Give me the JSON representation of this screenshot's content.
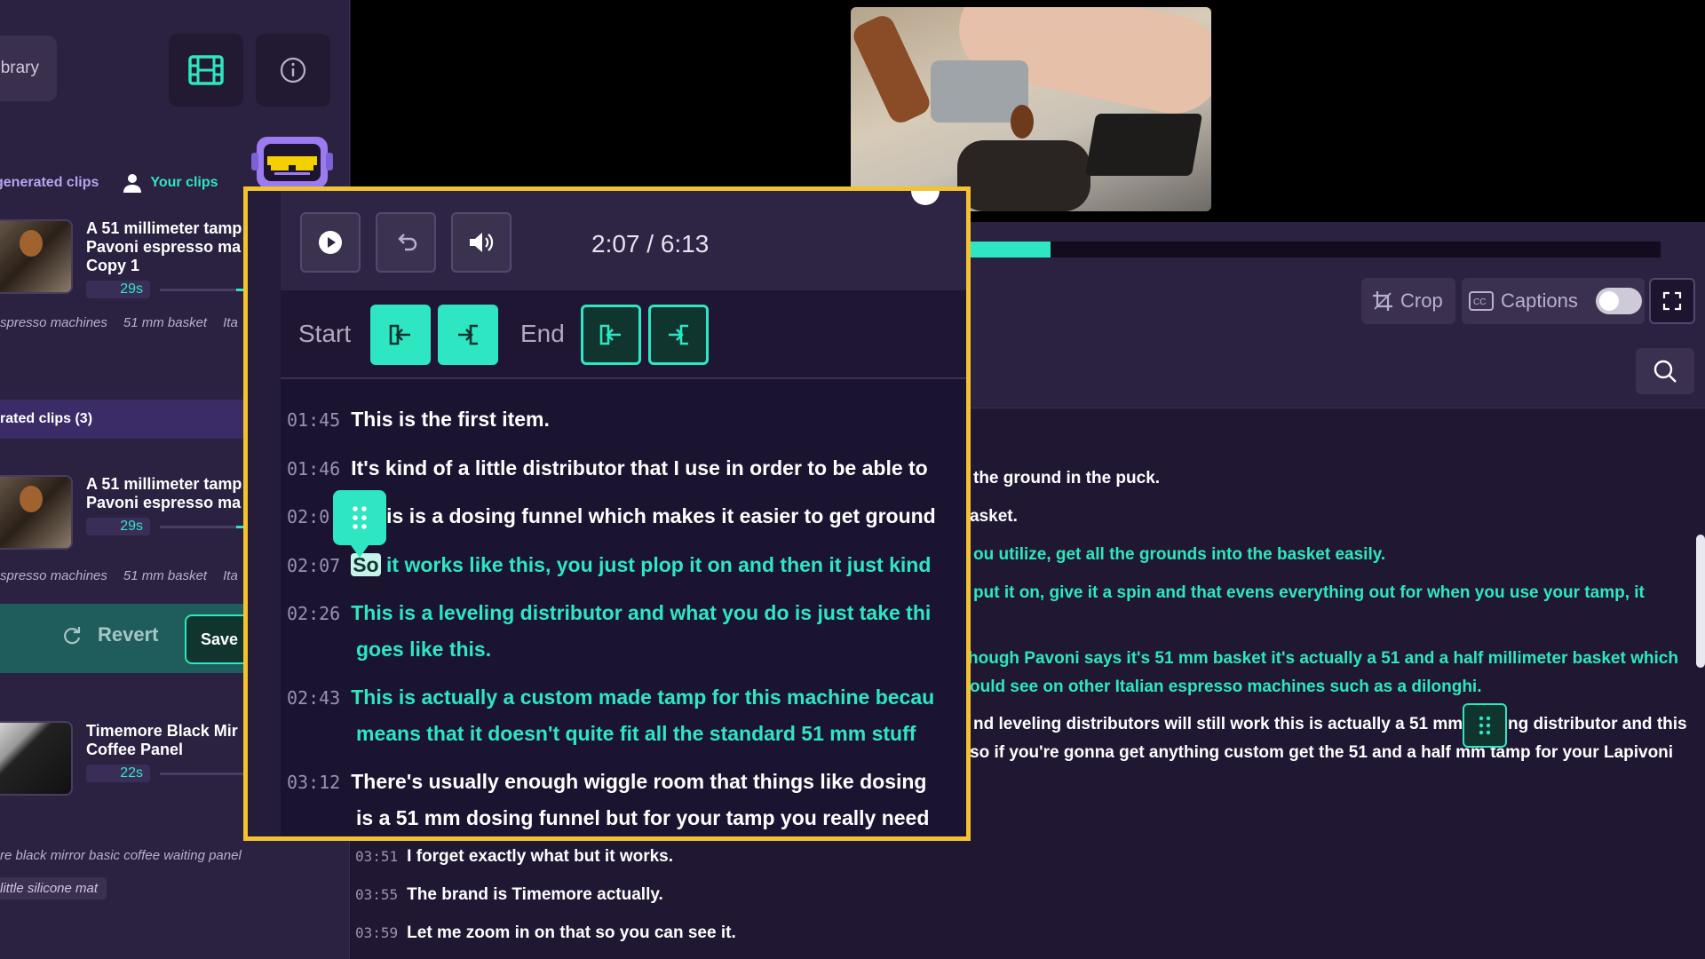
{
  "sidebar": {
    "library_label": "brary",
    "tabs": {
      "generated": "generated clips",
      "yours": "Your clips"
    },
    "clips_top": [
      {
        "title_lines": [
          "A 51 millimeter tamp",
          "Pavoni espresso ma",
          "Copy 1"
        ],
        "duration": "29s",
        "tags": [
          "spresso machines",
          "51 mm basket",
          "Ita"
        ]
      }
    ],
    "section_title": "rated clips (3)",
    "clips_section": [
      {
        "title_lines": [
          "A 51 millimeter tamp",
          "Pavoni espresso ma"
        ],
        "duration": "29s",
        "tags": [
          "spresso machines",
          "51 mm basket",
          "Ita"
        ]
      },
      {
        "title_lines": [
          "Timemore Black Mir",
          "Coffee Panel"
        ],
        "duration": "22s",
        "tags": [
          "re black mirror basic coffee waiting panel",
          "little silicone mat"
        ]
      }
    ],
    "revert_label": "Revert",
    "save_label": "Save"
  },
  "player": {
    "progress_fraction": 0.116,
    "crop_label": "Crop",
    "captions_label": "Captions",
    "captions_on": false
  },
  "transcript_right": [
    {
      "text": "the ground in the puck.",
      "color": "white"
    },
    {
      "text": "asket.",
      "color": "white"
    },
    {
      "text": "ou utilize, get all the grounds into the basket easily.",
      "color": "green"
    },
    {
      "text": "put it on, give it a spin and that evens everything out for when you use your tamp, it",
      "color": "green"
    },
    {
      "text": "hough Pavoni says it's 51 mm basket it's actually a 51 and a half millimeter basket which",
      "color": "green"
    },
    {
      "text": "ould see on other Italian espresso machines such as a dilonghi.",
      "color": "green"
    },
    {
      "text": "nd leveling distributors will still work this is actually a 51 mm",
      "color": "white"
    },
    {
      "text": "ng distributor and this",
      "color": "white"
    },
    {
      "text": "so if you're gonna get anything custom get the 51 and a half mm tamp for your Lapivoni",
      "color": "white"
    }
  ],
  "transcript_bottom": [
    {
      "time": "03:51",
      "text": "I forget exactly what but it works."
    },
    {
      "time": "03:55",
      "text": "The brand is Timemore actually."
    },
    {
      "time": "03:59",
      "text": "Let me zoom in on that so you can see it."
    }
  ],
  "zoom": {
    "time_display": "2:07 / 6:13",
    "start_label": "Start",
    "end_label": "End",
    "lines": [
      {
        "time": "01:45",
        "text": "This is the first item.",
        "color": "white"
      },
      {
        "time": "01:46",
        "text": "It's kind of a little distributor that I use in order to be able to",
        "color": "white"
      },
      {
        "time": "02:0",
        "text": "is is a dosing funnel which makes it easier to get ground",
        "color": "white"
      },
      {
        "time": "02:07",
        "highlight": "So",
        "text": "it works like this, you just plop it on and then it just kind",
        "color": "green"
      },
      {
        "time": "02:26",
        "text": "This is a leveling distributor and what you do is just take thi",
        "cont": "goes like this.",
        "color": "green"
      },
      {
        "time": "02:43",
        "text": "This is actually a custom made tamp for this machine becau",
        "cont": "means that it doesn't quite fit all the standard 51 mm stuff",
        "color": "green"
      },
      {
        "time": "03:12",
        "text": "There's usually enough wiggle room that things like dosing",
        "cont": "is a 51 mm dosing funnel but for your tamp you really need",
        "color": "white"
      }
    ]
  },
  "colors": {
    "accent": "#2ee6c2",
    "highlight_border": "#f2c230",
    "panel": "#2b2140",
    "section": "#3b2c68"
  }
}
